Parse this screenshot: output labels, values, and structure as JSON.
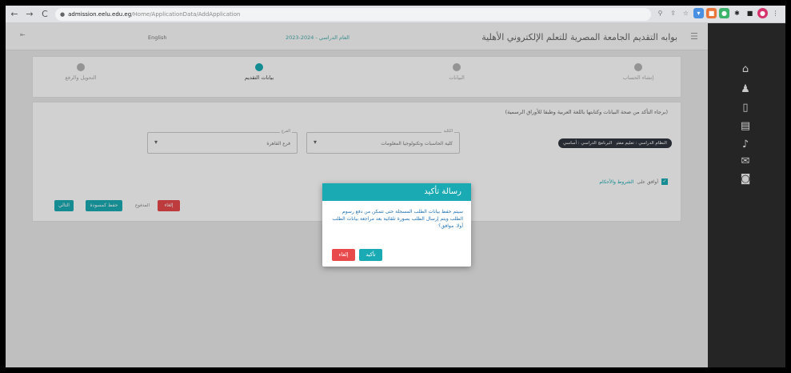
{
  "browser": {
    "url_host": "admission.eelu.edu.eg",
    "url_path": "/Home/ApplicationData/AddApplication",
    "back_icon": "←",
    "forward_icon": "→",
    "reload_icon": "C"
  },
  "header": {
    "title": "بوابه التقديم الجامعة المصرية للتعلم الإلكتروني الأهلية",
    "year_label": "2023-2024 - العام الدراسي",
    "language": "English"
  },
  "steps": [
    {
      "label": "إنشاء الحساب"
    },
    {
      "label": "البيانات"
    },
    {
      "label": "بيانات التقديم"
    },
    {
      "label": "التحويل والرفع"
    }
  ],
  "form": {
    "hint": "(برجاء التأكد من صحة البيانات وكتابتها باللغة العربية وطبقا للأوراق الرسمية)",
    "pills": [
      "النظام الدراسي : تعليم مفتوح",
      "البرنامج الدراسي : أساسي"
    ],
    "select1": {
      "label": "الكلية",
      "value": "كلية الحاسبات وتكنولوجيا المعلومات"
    },
    "select2": {
      "label": "الفرع",
      "value": "فرع القاهرة"
    },
    "confirm_text": "أوافق على",
    "confirm_link": "الشروط والأحكام",
    "buttons": {
      "next": "التالي",
      "save_draft": "حفظ كمسودة",
      "cancel": "إلغاء"
    },
    "note": "المدفوع"
  },
  "modal": {
    "title": "رسالة تأكيد",
    "body": "سيتم حفظ بيانات الطلب المسجلة حتى تتمكن من دفع رسوم الطلب ويتم إرسال الطلب بصورة تلقائية بعد مراجعة بيانات الطلب أولا. موافق؟",
    "confirm": "تأكيد",
    "cancel": "إلغاء"
  },
  "colors": {
    "accent": "#1aaab3",
    "danger": "#e8494b",
    "sidebar": "#252526"
  }
}
